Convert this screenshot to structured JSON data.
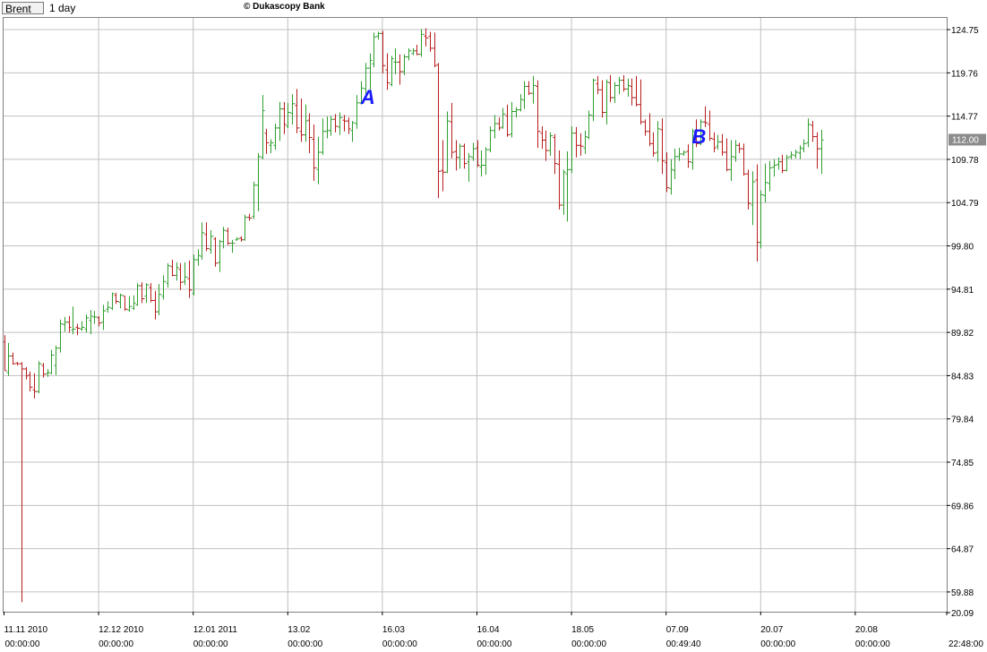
{
  "header": {
    "symbol": "Brent",
    "timeframe": "1 day",
    "brand": "© Dukascopy Bank"
  },
  "colors": {
    "up": "#2e9e2e",
    "down": "#b81c1c",
    "grid": "#c0c0c0",
    "annotation": "#1a1aff",
    "price_badge": "#8c8c8c"
  },
  "chart_data": {
    "type": "bar",
    "subtype": "ohlc",
    "ylim": [
      57.6,
      126.2
    ],
    "y_ticks": [
      "124.75",
      "119.76",
      "114.77",
      "109.78",
      "104.79",
      "99.80",
      "94.81",
      "89.82",
      "84.83",
      "79.84",
      "74.85",
      "69.86",
      "64.87",
      "59.88",
      "20.09"
    ],
    "y_tick_values": [
      124.75,
      119.76,
      114.77,
      109.78,
      104.79,
      99.8,
      94.81,
      89.82,
      84.83,
      79.84,
      74.85,
      69.86,
      64.87,
      59.88,
      null
    ],
    "x_ticks": [
      {
        "date": "11.11 2010",
        "time": "00:00:00",
        "index": 0
      },
      {
        "date": "12.12 2010",
        "time": "00:00:00",
        "index": 22
      },
      {
        "date": "12.01 2011",
        "time": "00:00:00",
        "index": 44
      },
      {
        "date": "13.02",
        "time": "00:00:00",
        "index": 66
      },
      {
        "date": "16.03",
        "time": "00:00:00",
        "index": 88
      },
      {
        "date": "16.04",
        "time": "00:00:00",
        "index": 110
      },
      {
        "date": "18.05",
        "time": "00:00:00",
        "index": 132
      },
      {
        "date": "07.09",
        "time": "00:49:40",
        "index": 154
      },
      {
        "date": "20.07",
        "time": "00:00:00",
        "index": 176
      },
      {
        "date": "20.08",
        "time": "00:00:00",
        "index": 198
      },
      {
        "date": "",
        "time": "22:48:00",
        "index": 220
      }
    ],
    "last_price": "112.00",
    "annotations": [
      {
        "text": "A",
        "index": 83,
        "y": 117.6
      },
      {
        "text": "B",
        "index": 160,
        "y": 113.1
      }
    ],
    "ohlc": [
      [
        88.7,
        89.5,
        85.4,
        85.4
      ],
      [
        85.2,
        88.6,
        84.8,
        87.1
      ],
      [
        87.1,
        87.5,
        86.1,
        86.2
      ],
      [
        86.3,
        86.4,
        86.0,
        86.2
      ],
      [
        86.2,
        86.4,
        58.7,
        85.6
      ],
      [
        85.6,
        85.8,
        84.4,
        84.8
      ],
      [
        84.9,
        85.3,
        83.0,
        83.5
      ],
      [
        83.2,
        85.1,
        82.2,
        83.0
      ],
      [
        83.0,
        86.5,
        82.8,
        86.2
      ],
      [
        86.0,
        86.3,
        84.6,
        85.0
      ],
      [
        85.1,
        85.6,
        84.7,
        85.2
      ],
      [
        85.1,
        87.8,
        85.0,
        87.2
      ],
      [
        86.0,
        88.3,
        84.9,
        88.0
      ],
      [
        88.0,
        91.3,
        87.5,
        90.8
      ],
      [
        90.7,
        91.6,
        89.9,
        91.0
      ],
      [
        91.0,
        91.7,
        89.8,
        90.4
      ],
      [
        90.1,
        92.8,
        89.6,
        90.2
      ],
      [
        90.4,
        90.8,
        89.5,
        90.3
      ],
      [
        90.2,
        91.1,
        90.0,
        90.4
      ],
      [
        90.2,
        91.9,
        89.8,
        91.5
      ],
      [
        91.2,
        92.4,
        89.6,
        91.7
      ],
      [
        91.6,
        92.3,
        90.8,
        91.6
      ],
      [
        91.5,
        91.7,
        90.5,
        90.9
      ],
      [
        91.0,
        93.0,
        90.1,
        92.3
      ],
      [
        92.5,
        93.4,
        92.1,
        92.7
      ],
      [
        92.6,
        94.4,
        92.4,
        94.3
      ],
      [
        94.1,
        94.4,
        93.1,
        93.4
      ],
      [
        93.3,
        94.3,
        92.6,
        94.1
      ],
      [
        94.0,
        94.0,
        92.3,
        92.5
      ],
      [
        92.4,
        94.0,
        92.2,
        92.8
      ],
      [
        92.6,
        94.1,
        92.4,
        93.2
      ],
      [
        93.0,
        95.5,
        92.9,
        95.2
      ],
      [
        95.2,
        95.6,
        93.2,
        93.7
      ],
      [
        94.0,
        95.5,
        93.2,
        95.3
      ],
      [
        95.0,
        95.5,
        93.3,
        93.5
      ],
      [
        93.5,
        94.6,
        91.3,
        92.2
      ],
      [
        92.2,
        95.4,
        91.8,
        94.2
      ],
      [
        94.0,
        96.4,
        93.6,
        95.7
      ],
      [
        95.5,
        97.8,
        95.0,
        97.5
      ],
      [
        97.4,
        98.2,
        96.3,
        96.4
      ],
      [
        96.4,
        97.9,
        95.8,
        97.3
      ],
      [
        97.1,
        97.8,
        94.7,
        95.6
      ],
      [
        95.7,
        97.9,
        95.3,
        96.2
      ],
      [
        96.0,
        98.1,
        93.8,
        94.7
      ],
      [
        94.3,
        98.8,
        94.1,
        98.2
      ],
      [
        98.2,
        99.4,
        97.5,
        98.7
      ],
      [
        98.6,
        102.5,
        98.2,
        101.3
      ],
      [
        101.1,
        102.5,
        99.2,
        99.5
      ],
      [
        99.4,
        101.6,
        98.9,
        100.9
      ],
      [
        100.6,
        100.8,
        97.4,
        97.8
      ],
      [
        97.9,
        100.5,
        96.8,
        100.3
      ],
      [
        100.3,
        102.0,
        99.5,
        101.6
      ],
      [
        101.5,
        101.9,
        99.9,
        100.1
      ],
      [
        100.1,
        100.5,
        99.0,
        100.1
      ],
      [
        100.5,
        100.8,
        100.4,
        100.6
      ],
      [
        100.7,
        100.9,
        100.3,
        100.5
      ],
      [
        100.5,
        103.4,
        100.4,
        103.1
      ],
      [
        103.1,
        103.5,
        102.7,
        103.0
      ],
      [
        103.2,
        107.2,
        102.9,
        106.8
      ],
      [
        106.8,
        110.5,
        103.8,
        110.1
      ],
      [
        110.0,
        117.2,
        109.8,
        115.4
      ],
      [
        112.8,
        113.3,
        110.4,
        111.7
      ],
      [
        111.4,
        112.1,
        110.5,
        111.7
      ],
      [
        111.4,
        113.9,
        110.9,
        113.4
      ],
      [
        113.4,
        116.4,
        111.9,
        115.6
      ],
      [
        115.6,
        116.4,
        112.7,
        113.8
      ],
      [
        113.6,
        116.3,
        113.4,
        115.2
      ],
      [
        115.1,
        117.3,
        113.8,
        116.2
      ],
      [
        116.0,
        117.9,
        112.8,
        113.4
      ],
      [
        113.0,
        116.8,
        111.8,
        112.6
      ],
      [
        112.6,
        116.1,
        111.8,
        114.2
      ],
      [
        114.3,
        115.1,
        110.5,
        112.3
      ],
      [
        112.1,
        113.8,
        107.3,
        108.8
      ],
      [
        108.6,
        112.4,
        106.9,
        110.6
      ],
      [
        110.6,
        114.5,
        110.3,
        113.0
      ],
      [
        113.0,
        114.7,
        112.2,
        113.1
      ],
      [
        113.1,
        114.8,
        112.5,
        114.4
      ],
      [
        114.4,
        115.0,
        112.9,
        113.6
      ],
      [
        113.5,
        115.2,
        112.6,
        114.6
      ],
      [
        114.3,
        114.9,
        113.0,
        114.2
      ],
      [
        114.2,
        114.6,
        112.7,
        113.3
      ],
      [
        113.1,
        114.2,
        111.8,
        114.0
      ],
      [
        113.9,
        117.2,
        113.3,
        116.3
      ],
      [
        116.3,
        118.8,
        116.1,
        118.0
      ],
      [
        117.9,
        120.9,
        117.2,
        120.3
      ],
      [
        120.3,
        122.0,
        117.2,
        121.2
      ],
      [
        120.8,
        124.4,
        120.4,
        123.9
      ],
      [
        124.0,
        124.5,
        123.6,
        124.3
      ],
      [
        124.3,
        124.6,
        119.7,
        120.6
      ],
      [
        120.1,
        122.0,
        117.8,
        118.6
      ],
      [
        118.4,
        121.7,
        118.2,
        121.4
      ],
      [
        121.0,
        122.6,
        119.6,
        121.0
      ],
      [
        121.0,
        121.9,
        118.4,
        119.9
      ],
      [
        119.9,
        121.9,
        119.5,
        121.6
      ],
      [
        121.6,
        122.6,
        121.2,
        122.3
      ],
      [
        122.0,
        122.6,
        121.8,
        122.3
      ],
      [
        122.3,
        123.0,
        121.8,
        121.9
      ],
      [
        121.9,
        124.8,
        121.6,
        124.2
      ],
      [
        124.0,
        124.9,
        122.8,
        123.8
      ],
      [
        124.0,
        124.5,
        122.2,
        122.6
      ],
      [
        122.6,
        124.4,
        120.4,
        120.6
      ],
      [
        120.7,
        120.9,
        105.3,
        108.4
      ],
      [
        108.5,
        112.0,
        106.1,
        108.3
      ],
      [
        108.3,
        115.3,
        108.2,
        114.2
      ],
      [
        114.1,
        116.3,
        109.9,
        110.6
      ],
      [
        110.7,
        112.0,
        108.5,
        110.0
      ],
      [
        110.0,
        111.6,
        108.7,
        111.3
      ],
      [
        111.3,
        111.6,
        108.7,
        109.3
      ],
      [
        109.5,
        110.5,
        107.2,
        110.1
      ],
      [
        110.0,
        111.7,
        109.6,
        111.0
      ],
      [
        111.1,
        112.0,
        108.9,
        109.1
      ],
      [
        108.9,
        110.8,
        107.8,
        109.1
      ],
      [
        109.1,
        111.2,
        108.0,
        110.9
      ],
      [
        110.9,
        113.6,
        110.6,
        113.1
      ],
      [
        113.1,
        114.9,
        112.2,
        113.9
      ],
      [
        113.9,
        114.6,
        113.1,
        113.4
      ],
      [
        113.5,
        115.7,
        113.3,
        115.0
      ],
      [
        114.8,
        116.1,
        112.4,
        112.6
      ],
      [
        112.7,
        116.4,
        112.3,
        115.3
      ],
      [
        115.3,
        115.8,
        114.6,
        115.5
      ],
      [
        115.5,
        117.3,
        115.3,
        116.7
      ],
      [
        116.6,
        118.8,
        115.6,
        118.2
      ],
      [
        118.2,
        118.8,
        117.2,
        117.4
      ],
      [
        117.4,
        119.4,
        116.2,
        118.3
      ],
      [
        118.2,
        118.9,
        111.1,
        113.0
      ],
      [
        112.8,
        113.6,
        111.0,
        112.0
      ],
      [
        112.0,
        113.1,
        109.6,
        110.8
      ],
      [
        110.8,
        112.9,
        110.2,
        112.5
      ],
      [
        112.3,
        112.7,
        108.1,
        109.3
      ],
      [
        109.2,
        110.8,
        104.0,
        104.5
      ],
      [
        104.5,
        108.6,
        103.4,
        108.3
      ],
      [
        108.1,
        110.7,
        102.6,
        108.6
      ],
      [
        108.6,
        113.6,
        108.2,
        112.8
      ],
      [
        112.8,
        113.5,
        110.0,
        111.4
      ],
      [
        111.4,
        112.8,
        110.2,
        111.3
      ],
      [
        111.1,
        113.1,
        110.4,
        112.4
      ],
      [
        112.3,
        115.4,
        112.1,
        114.9
      ],
      [
        114.8,
        119.1,
        114.2,
        118.9
      ],
      [
        118.5,
        119.4,
        117.3,
        117.8
      ],
      [
        117.8,
        118.9,
        114.6,
        115.2
      ],
      [
        115.2,
        119.0,
        113.8,
        118.7
      ],
      [
        118.6,
        119.5,
        116.4,
        116.9
      ],
      [
        116.9,
        118.7,
        116.3,
        118.3
      ],
      [
        118.3,
        119.3,
        117.3,
        118.9
      ],
      [
        118.9,
        119.5,
        117.6,
        117.9
      ],
      [
        117.9,
        119.1,
        117.0,
        118.3
      ],
      [
        118.2,
        119.1,
        116.0,
        116.9
      ],
      [
        116.9,
        119.4,
        115.9,
        116.1
      ],
      [
        116.1,
        119.0,
        113.8,
        114.1
      ],
      [
        114.1,
        114.4,
        112.5,
        113.0
      ],
      [
        113.0,
        115.1,
        111.3,
        111.6
      ],
      [
        111.6,
        112.9,
        110.1,
        110.5
      ],
      [
        110.6,
        114.2,
        109.5,
        113.3
      ],
      [
        113.2,
        114.5,
        108.1,
        109.6
      ],
      [
        109.4,
        110.6,
        106.0,
        106.5
      ],
      [
        106.4,
        109.8,
        105.7,
        108.6
      ],
      [
        108.5,
        111.0,
        107.5,
        110.1
      ],
      [
        110.1,
        111.1,
        109.6,
        110.4
      ],
      [
        110.4,
        110.8,
        110.2,
        110.6
      ],
      [
        110.7,
        111.5,
        108.8,
        109.5
      ],
      [
        109.4,
        113.3,
        108.6,
        113.0
      ],
      [
        113.0,
        114.4,
        111.2,
        111.6
      ],
      [
        111.6,
        114.4,
        111.4,
        114.1
      ],
      [
        114.1,
        115.9,
        113.5,
        114.0
      ],
      [
        113.8,
        115.4,
        111.9,
        112.2
      ],
      [
        112.1,
        112.9,
        110.6,
        111.1
      ],
      [
        111.3,
        112.6,
        110.9,
        111.8
      ],
      [
        111.8,
        112.7,
        110.2,
        110.6
      ],
      [
        110.6,
        112.2,
        108.4,
        108.6
      ],
      [
        108.6,
        112.0,
        107.3,
        110.1
      ],
      [
        110.0,
        112.0,
        109.5,
        111.4
      ],
      [
        111.4,
        111.7,
        110.5,
        111.0
      ],
      [
        111.0,
        111.6,
        107.9,
        108.1
      ],
      [
        108.1,
        108.6,
        104.0,
        104.7
      ],
      [
        104.5,
        108.4,
        102.2,
        107.2
      ],
      [
        107.4,
        109.2,
        98.0,
        100.2
      ],
      [
        100.2,
        106.2,
        99.5,
        105.7
      ],
      [
        105.6,
        109.3,
        104.8,
        107.1
      ],
      [
        107.0,
        109.6,
        106.1,
        108.8
      ],
      [
        108.9,
        109.8,
        107.8,
        109.1
      ],
      [
        109.2,
        110.0,
        108.6,
        109.5
      ],
      [
        109.5,
        110.3,
        108.2,
        108.5
      ],
      [
        108.5,
        110.3,
        108.4,
        110.0
      ],
      [
        110.1,
        110.7,
        109.8,
        110.3
      ],
      [
        110.2,
        110.9,
        109.9,
        110.6
      ],
      [
        110.5,
        111.4,
        109.8,
        111.1
      ],
      [
        111.0,
        112.1,
        110.6,
        111.6
      ],
      [
        111.7,
        114.5,
        111.2,
        113.8
      ],
      [
        113.7,
        114.2,
        111.8,
        112.4
      ],
      [
        112.4,
        112.9,
        108.7,
        111.0
      ],
      [
        111.0,
        113.2,
        108.1,
        112.0
      ]
    ]
  }
}
